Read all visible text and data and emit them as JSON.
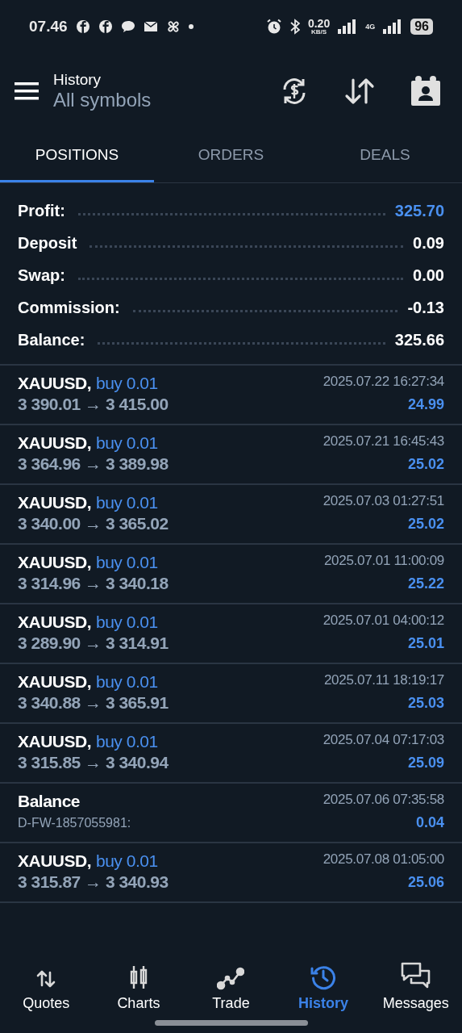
{
  "status_bar": {
    "time": "07.46",
    "speed": "0.20",
    "speed_unit": "KB/S",
    "network": "4G",
    "battery": "96"
  },
  "header": {
    "title": "History",
    "subtitle": "All symbols"
  },
  "tabs": [
    {
      "label": "POSITIONS",
      "selected": true
    },
    {
      "label": "ORDERS",
      "selected": false
    },
    {
      "label": "DEALS",
      "selected": false
    }
  ],
  "summary": [
    {
      "label": "Profit:",
      "value": "325.70",
      "highlight": true
    },
    {
      "label": "Deposit",
      "value": "0.09",
      "highlight": false
    },
    {
      "label": "Swap:",
      "value": "0.00",
      "highlight": false
    },
    {
      "label": "Commission:",
      "value": "-0.13",
      "highlight": false
    },
    {
      "label": "Balance:",
      "value": "325.66",
      "highlight": false
    }
  ],
  "entries": [
    {
      "kind": "trade",
      "symbol": "XAUUSD,",
      "side": "buy 0.01",
      "prices": "3 390.01 → 3 415.00",
      "time": "2025.07.22 16:27:34",
      "profit": "24.99"
    },
    {
      "kind": "trade",
      "symbol": "XAUUSD,",
      "side": "buy 0.01",
      "prices": "3 364.96 → 3 389.98",
      "time": "2025.07.21 16:45:43",
      "profit": "25.02"
    },
    {
      "kind": "trade",
      "symbol": "XAUUSD,",
      "side": "buy 0.01",
      "prices": "3 340.00 → 3 365.02",
      "time": "2025.07.03 01:27:51",
      "profit": "25.02"
    },
    {
      "kind": "trade",
      "symbol": "XAUUSD,",
      "side": "buy 0.01",
      "prices": "3 314.96 → 3 340.18",
      "time": "2025.07.01 11:00:09",
      "profit": "25.22"
    },
    {
      "kind": "trade",
      "symbol": "XAUUSD,",
      "side": "buy 0.01",
      "prices": "3 289.90 → 3 314.91",
      "time": "2025.07.01 04:00:12",
      "profit": "25.01"
    },
    {
      "kind": "trade",
      "symbol": "XAUUSD,",
      "side": "buy 0.01",
      "prices": "3 340.88 → 3 365.91",
      "time": "2025.07.11 18:19:17",
      "profit": "25.03"
    },
    {
      "kind": "trade",
      "symbol": "XAUUSD,",
      "side": "buy 0.01",
      "prices": "3 315.85 → 3 340.94",
      "time": "2025.07.04 07:17:03",
      "profit": "25.09"
    },
    {
      "kind": "balance",
      "title": "Balance",
      "comment": "D-FW-1857055981:",
      "time": "2025.07.06 07:35:58",
      "profit": "0.04"
    },
    {
      "kind": "trade",
      "symbol": "XAUUSD,",
      "side": "buy 0.01",
      "prices": "3 315.87 → 3 340.93",
      "time": "2025.07.08 01:05:00",
      "profit": "25.06"
    }
  ],
  "nav": [
    {
      "kind": "quotes",
      "label": "Quotes",
      "selected": false
    },
    {
      "kind": "charts",
      "label": "Charts",
      "selected": false
    },
    {
      "kind": "trade",
      "label": "Trade",
      "selected": false
    },
    {
      "kind": "history",
      "label": "History",
      "selected": true
    },
    {
      "kind": "messages",
      "label": "Messages",
      "selected": false
    }
  ]
}
